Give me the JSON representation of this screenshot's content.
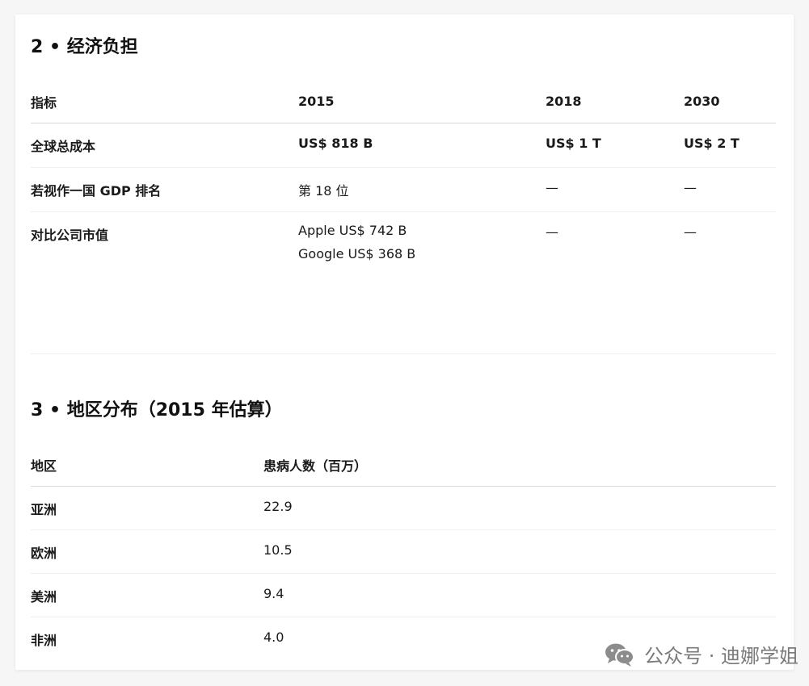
{
  "section2": {
    "title": "2 • 经济负担",
    "headers": [
      "指标",
      "2015",
      "2018",
      "2030"
    ],
    "rows": [
      {
        "label": "全球总成本",
        "v2015": "US$ 818 B",
        "v2018": "US$ 1 T",
        "v2030": "US$ 2 T"
      },
      {
        "label": "若视作一国 GDP 排名",
        "v2015": "第 18 位",
        "v2018": "—",
        "v2030": "—"
      },
      {
        "label": "对比公司市值",
        "v2015_line1": "Apple US$ 742 B",
        "v2015_line2": "Google US$ 368 B",
        "v2018": "—",
        "v2030": "—"
      }
    ]
  },
  "section3": {
    "title": "3 • 地区分布（2015 年估算）",
    "headers": [
      "地区",
      "患病人数（百万）"
    ],
    "rows": [
      {
        "region": "亚洲",
        "value": "22.9"
      },
      {
        "region": "欧洲",
        "value": "10.5"
      },
      {
        "region": "美洲",
        "value": "9.4"
      },
      {
        "region": "非洲",
        "value": "4.0"
      }
    ]
  },
  "watermark": {
    "text": "公众号 · 迪娜学姐",
    "icon": "wechat-icon"
  }
}
